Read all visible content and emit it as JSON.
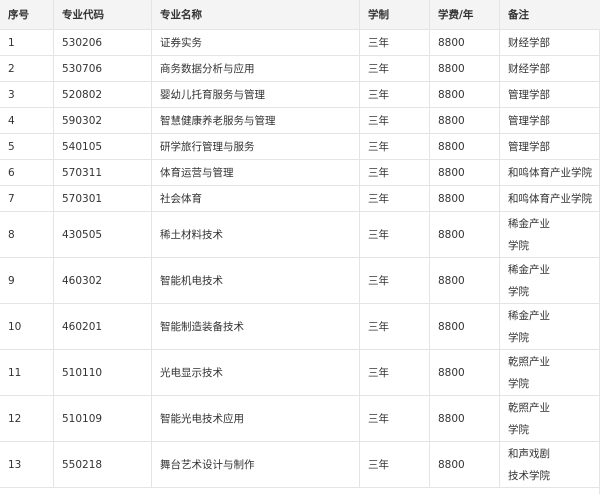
{
  "table": {
    "headers": [
      "序号",
      "专业代码",
      "专业名称",
      "学制",
      "学费/年",
      "备注"
    ],
    "rows": [
      {
        "no": "1",
        "code": "530206",
        "name": "证券实务",
        "years": "三年",
        "fee": "8800",
        "note": [
          "财经学部"
        ]
      },
      {
        "no": "2",
        "code": "530706",
        "name": "商务数据分析与应用",
        "years": "三年",
        "fee": "8800",
        "note": [
          "财经学部"
        ]
      },
      {
        "no": "3",
        "code": "520802",
        "name": "婴幼儿托育服务与管理",
        "years": "三年",
        "fee": "8800",
        "note": [
          "管理学部"
        ]
      },
      {
        "no": "4",
        "code": "590302",
        "name": "智慧健康养老服务与管理",
        "years": "三年",
        "fee": "8800",
        "note": [
          "管理学部"
        ]
      },
      {
        "no": "5",
        "code": "540105",
        "name": "研学旅行管理与服务",
        "years": "三年",
        "fee": "8800",
        "note": [
          "管理学部"
        ]
      },
      {
        "no": "6",
        "code": "570311",
        "name": "体育运营与管理",
        "years": "三年",
        "fee": "8800",
        "note": [
          "和鸣体育产业学院"
        ]
      },
      {
        "no": "7",
        "code": "570301",
        "name": "社会体育",
        "years": "三年",
        "fee": "8800",
        "note": [
          "和鸣体育产业学院"
        ]
      },
      {
        "no": "8",
        "code": "430505",
        "name": "稀土材料技术",
        "years": "三年",
        "fee": "8800",
        "note": [
          "稀金产业",
          "学院"
        ]
      },
      {
        "no": "9",
        "code": "460302",
        "name": "智能机电技术",
        "years": "三年",
        "fee": "8800",
        "note": [
          "稀金产业",
          "学院"
        ]
      },
      {
        "no": "10",
        "code": "460201",
        "name": "智能制造装备技术",
        "years": "三年",
        "fee": "8800",
        "note": [
          "稀金产业",
          "学院"
        ]
      },
      {
        "no": "11",
        "code": "510110",
        "name": "光电显示技术",
        "years": "三年",
        "fee": "8800",
        "note": [
          "乾照产业",
          "学院"
        ]
      },
      {
        "no": "12",
        "code": "510109",
        "name": "智能光电技术应用",
        "years": "三年",
        "fee": "8800",
        "note": [
          "乾照产业",
          "学院"
        ]
      },
      {
        "no": "13",
        "code": "550218",
        "name": "舞台艺术设计与制作",
        "years": "三年",
        "fee": "8800",
        "note": [
          "和声戏剧",
          "技术学院"
        ]
      }
    ]
  }
}
